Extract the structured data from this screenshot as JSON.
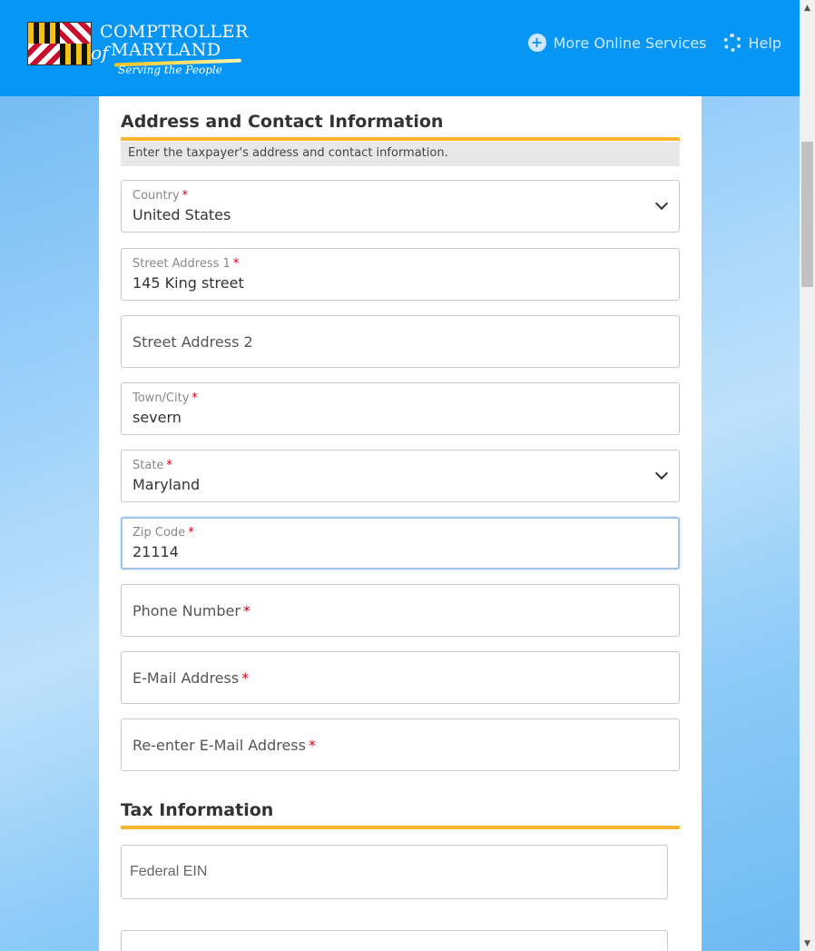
{
  "header": {
    "logo": {
      "line1": "COMPTROLLER",
      "of": "of",
      "line2": "MARYLAND",
      "tagline": "Serving the People"
    },
    "links": [
      {
        "label": "More Online Services",
        "icon": "plus-circle-icon"
      },
      {
        "label": "Help",
        "icon": "help-lifebuoy-icon"
      }
    ]
  },
  "address_section": {
    "title": "Address and Contact Information",
    "instructions": "Enter the taxpayer's address and contact information.",
    "fields": {
      "country": {
        "label": "Country",
        "value": "United States"
      },
      "street1": {
        "label": "Street Address 1",
        "value": "145 King street"
      },
      "street2": {
        "placeholder": "Street Address 2"
      },
      "city": {
        "label": "Town/City",
        "value": "severn"
      },
      "state": {
        "label": "State",
        "value": "Maryland"
      },
      "zip": {
        "label": "Zip Code",
        "value": "21114"
      },
      "phone": {
        "placeholder": "Phone Number"
      },
      "email": {
        "placeholder": "E-Mail Address"
      },
      "email_confirm": {
        "placeholder": "Re-enter E-Mail Address"
      }
    },
    "required_marker": "*"
  },
  "tax_section": {
    "title": "Tax Information",
    "fields": {
      "federal_ein": {
        "placeholder": "Federal EIN"
      }
    }
  },
  "colors": {
    "header_bg": "#0896f5",
    "accent_rule": "#fbb330",
    "required": "#d0021b"
  }
}
